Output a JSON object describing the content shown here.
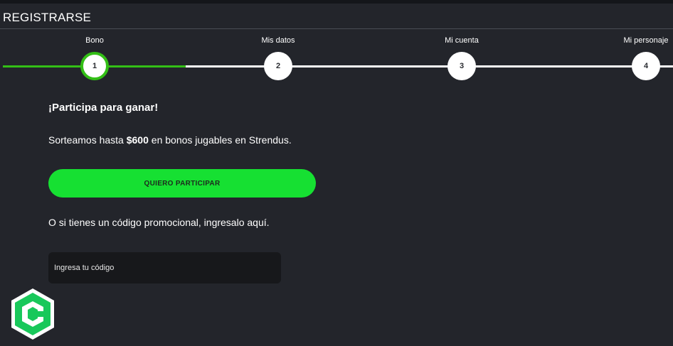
{
  "page": {
    "title": "REGISTRARSE"
  },
  "stepper": {
    "current_step": 1,
    "steps": [
      {
        "label": "Bono",
        "number": "1"
      },
      {
        "label": "Mis datos",
        "number": "2"
      },
      {
        "label": "Mi cuenta",
        "number": "3"
      },
      {
        "label": "Mi personaje",
        "number": "4"
      }
    ]
  },
  "bonus": {
    "heading": "¡Participa para ganar!",
    "promo_prefix": "Sorteamos hasta ",
    "promo_amount": "$600",
    "promo_suffix": " en bonos jugables en Strendus.",
    "participate_label": "QUIERO PARTICIPAR",
    "code_hint": "O si tienes un código promocional, ingresalo aquí.",
    "code_placeholder": "Ingresa tu código",
    "code_value": ""
  },
  "colors": {
    "background": "#23252b",
    "accent_green": "#16e032",
    "progress_green": "#33bf16",
    "input_bg": "#17181b"
  },
  "icons": {
    "logo": "strendus-hexagon-logo-icon"
  }
}
